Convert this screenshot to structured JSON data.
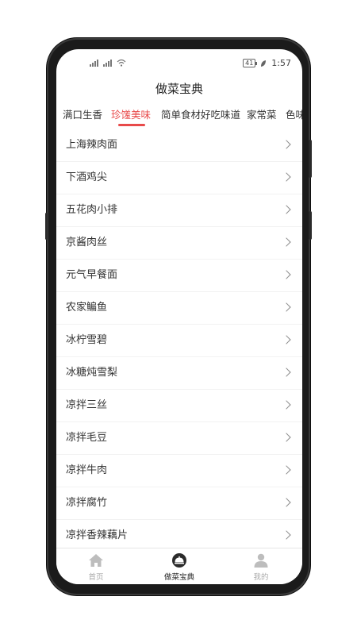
{
  "status_bar": {
    "time": "1:57",
    "battery": "41",
    "icons": [
      "signal-off-icon",
      "signal-off-icon",
      "wifi-icon",
      "leaf-icon"
    ]
  },
  "app_title": "做菜宝典",
  "tabs": [
    {
      "label": "满口生香",
      "active": false
    },
    {
      "label": "珍馐美味",
      "active": true
    },
    {
      "label": "简单食材好吃味道",
      "active": false
    },
    {
      "label": "家常菜",
      "active": false
    },
    {
      "label": "色味",
      "active": false
    }
  ],
  "recipes": [
    "上海辣肉面",
    "下酒鸡尖",
    "五花肉小排",
    "京酱肉丝",
    "元气早餐面",
    "农家鳊鱼",
    "冰柠雪碧",
    "冰糖炖雪梨",
    "凉拌三丝",
    "凉拌毛豆",
    "凉拌牛肉",
    "凉拌腐竹",
    "凉拌香辣藕片"
  ],
  "bottom_nav": [
    {
      "label": "首页",
      "icon": "home-icon",
      "active": false
    },
    {
      "label": "做菜宝典",
      "icon": "dish-cloche-icon",
      "active": true
    },
    {
      "label": "我的",
      "icon": "person-icon",
      "active": false
    }
  ],
  "colors": {
    "accent": "#e84a4a",
    "phone_frame": "#1b1b1b",
    "list_bg": "#f2f2f2",
    "inactive_nav": "#aaaaaa"
  }
}
